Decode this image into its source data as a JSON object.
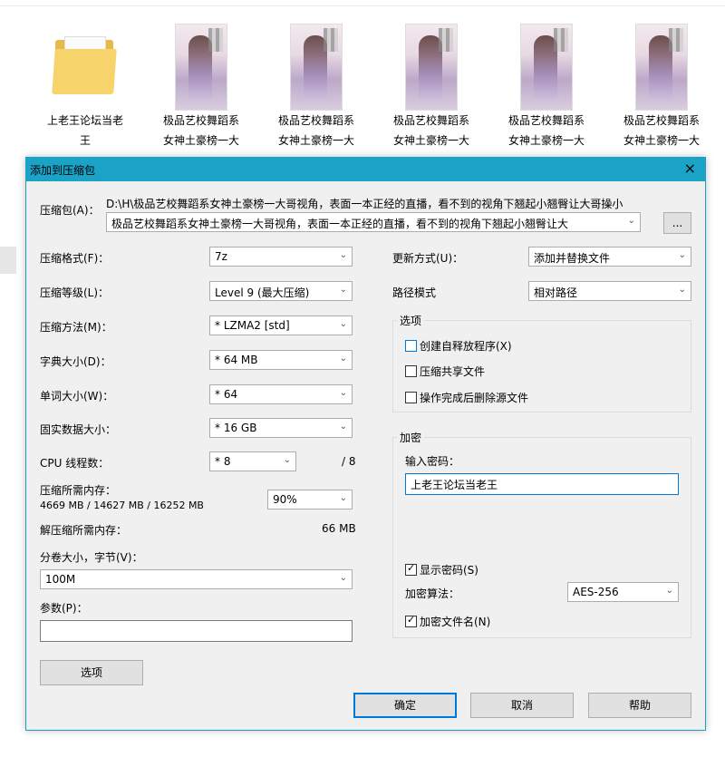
{
  "explorer": {
    "files": [
      {
        "name_line1": "上老王论坛当老",
        "name_line2": "王",
        "type": "folder"
      },
      {
        "name_line1": "极品艺校舞蹈系",
        "name_line2": "女神土豪榜一大",
        "type": "image"
      },
      {
        "name_line1": "极品艺校舞蹈系",
        "name_line2": "女神土豪榜一大",
        "type": "image"
      },
      {
        "name_line1": "极品艺校舞蹈系",
        "name_line2": "女神土豪榜一大",
        "type": "image"
      },
      {
        "name_line1": "极品艺校舞蹈系",
        "name_line2": "女神土豪榜一大",
        "type": "image"
      },
      {
        "name_line1": "极品艺校舞蹈系",
        "name_line2": "女神土豪榜一大",
        "type": "image"
      }
    ]
  },
  "dialog": {
    "title": "添加到压缩包",
    "close_icon": "×",
    "archive": {
      "label": "压缩包(A)：",
      "path": "D:\\H\\极品艺校舞蹈系女神土豪榜一大哥视角，表面一本正经的直播，看不到的视角下翘起小翘臀让大哥操小",
      "filename": "极品艺校舞蹈系女神土豪榜一大哥视角，表面一本正经的直播，看不到的视角下翘起小翘臀让大",
      "browse_label": "..."
    },
    "left": {
      "format": {
        "label": "压缩格式(F)：",
        "value": "7z"
      },
      "level": {
        "label": "压缩等级(L)：",
        "value": "Level 9 (最大压缩)"
      },
      "method": {
        "label": "压缩方法(M)：",
        "value": "* LZMA2 [std]"
      },
      "dict": {
        "label": "字典大小(D)：",
        "value": "* 64 MB"
      },
      "word": {
        "label": "单词大小(W)：",
        "value": "* 64"
      },
      "solid": {
        "label": "固实数据大小：",
        "value": "* 16 GB"
      },
      "threads": {
        "label": "CPU 线程数：",
        "value": "* 8",
        "max": "/ 8"
      },
      "mem": {
        "label": "压缩所需内存：",
        "detail": "4669 MB / 14627 MB / 16252 MB",
        "value": "90%"
      },
      "decomp": {
        "label": "解压缩所需内存：",
        "value": "66 MB"
      },
      "volume": {
        "label": "分卷大小，字节(V)：",
        "value": "100M"
      },
      "params": {
        "label": "参数(P)：",
        "value": ""
      },
      "options_button": "选项"
    },
    "right": {
      "update": {
        "label": "更新方式(U)：",
        "value": "添加并替换文件"
      },
      "pathmode": {
        "label": "路径模式",
        "value": "相对路径"
      },
      "options_group": {
        "title": "选项",
        "sfx": {
          "label": "创建自释放程序(X)",
          "checked": false
        },
        "shared": {
          "label": "压缩共享文件",
          "checked": false
        },
        "delete": {
          "label": "操作完成后删除源文件",
          "checked": false
        }
      },
      "encryption_group": {
        "title": "加密",
        "password_label": "输入密码：",
        "password_value": "上老王论坛当老王",
        "show_password": {
          "label": "显示密码(S)",
          "checked": true
        },
        "algo_label": "加密算法：",
        "algo_value": "AES-256",
        "encrypt_names": {
          "label": "加密文件名(N)",
          "checked": true
        }
      }
    },
    "buttons": {
      "ok": "确定",
      "cancel": "取消",
      "help": "帮助"
    }
  }
}
